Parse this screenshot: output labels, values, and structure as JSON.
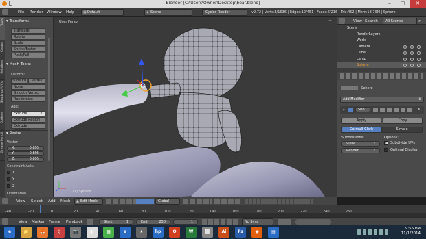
{
  "window": {
    "title": "Blender  [C:\\Users\\Owner\\Desktop\\bear.blend]",
    "minimize": "–",
    "maximize": "□",
    "close": "✕"
  },
  "menubar": {
    "items": [
      "File",
      "Render",
      "Window",
      "Help"
    ],
    "screen_layout": "Default",
    "scene": "Scene",
    "render_engine": "Cycles Render",
    "stats": "v2.72 | Verts:8/1636 | Edges:12/451 | Faces:6/216 | Tris:452 | Mem:18.79M | Sphere"
  },
  "viewport": {
    "view_label": "User Persp",
    "object_label": "(1) Sphere"
  },
  "toolshelf": {
    "tabs": [
      "Tools",
      "Create",
      "Relations",
      "Shading / UVs",
      "Options",
      "Grease Pencil"
    ],
    "transform_header": "▾ Transform:",
    "transform_buttons": [
      "Translate",
      "Rotate",
      "Scale",
      "Shrink/Fatten",
      "Push/Pull"
    ],
    "mesh_tools_header": "▾ Mesh Tools:",
    "deform_label": "Deform:",
    "deform_row": [
      "Slide Ed",
      "Vertex"
    ],
    "deform_buttons": [
      "Noise",
      "Smooth Vertex",
      "Randomize"
    ],
    "add_label": "Add:",
    "add_buttons": [
      "Extrude",
      "Extrude Region",
      "Extrude Individual"
    ],
    "resize_header": "▾ Resize",
    "vector_label": "Vector",
    "vector": [
      {
        "axis": "X:",
        "value": "0.895"
      },
      {
        "axis": "Y:",
        "value": "0.895"
      },
      {
        "axis": "Z:",
        "value": "0.895"
      }
    ],
    "constraint_label": "Constraint Axis:",
    "constraint_axes": [
      "X",
      "Y",
      "Z"
    ],
    "orientation_label": "Orientation"
  },
  "outliner": {
    "view": "View",
    "search": "Search",
    "filter": "All Scenes",
    "rows": [
      "Scene",
      "RenderLayers",
      "World",
      "Camera",
      "Cube",
      "Lamp",
      "Sphere"
    ]
  },
  "properties": {
    "object_name": "Sphere",
    "add_modifier": "Add Modifier",
    "modifier_name": "Sub",
    "apply": "Apply",
    "copy": "Copy",
    "catmull_clark": "Catmull-Clark",
    "simple": "Simple",
    "subdivisions_label": "Subdivisions:",
    "options_label": "Options:",
    "view_label": "View",
    "view_value": "2",
    "render_label": "Render",
    "render_value": "2",
    "subdivide_uvs": "Subdivide UVs",
    "optimal_display": "Optimal Display"
  },
  "vp_header": {
    "items": [
      "View",
      "Select",
      "Add",
      "Mesh"
    ],
    "mode": "Edit Mode",
    "orientation": "Global"
  },
  "timeline": {
    "ticks": [
      "-40",
      "-20",
      "0",
      "20",
      "40",
      "60",
      "80",
      "100",
      "120",
      "140",
      "160",
      "180",
      "200",
      "220",
      "240",
      "260"
    ],
    "menu": [
      "View",
      "Marker",
      "Frame",
      "Playback"
    ],
    "start_label": "Start:",
    "start_value": "1",
    "end_label": "End:",
    "end_value": "250",
    "current": "1",
    "sync": "No Sync"
  },
  "taskbar": {
    "apps": [
      "e",
      "📁",
      "🦊",
      "♫",
      "📷",
      "◐",
      "▦",
      "e",
      "★",
      "hp",
      "O",
      "W",
      "⬜",
      "Ai",
      "Ps",
      "◉",
      "▤"
    ],
    "time": "9:56 PM",
    "date": "11/1/2014"
  },
  "colors": {
    "accent_blue": "#5680c2",
    "selected_orange": "#f0a030",
    "x_axis": "#dd3333",
    "y_axis": "#44cc44",
    "z_axis": "#3355ee"
  }
}
